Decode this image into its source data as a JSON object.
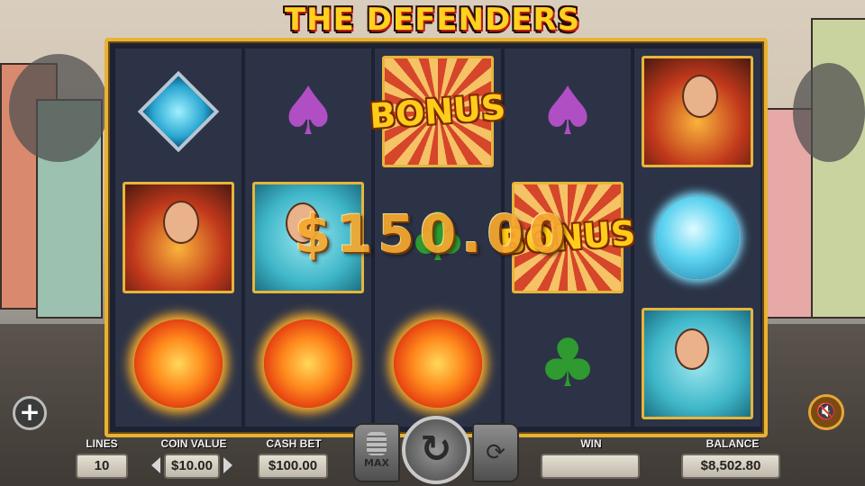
{
  "title": "THE DEFENDERS",
  "reels": [
    [
      "diamond-gem",
      "hero",
      "fire-orb"
    ],
    [
      "spade",
      "heroine",
      "fire-orb"
    ],
    [
      "bonus",
      "club",
      "fire-orb"
    ],
    [
      "spade",
      "bonus",
      "club"
    ],
    [
      "hero",
      "ice-orb",
      "heroine"
    ]
  ],
  "bonus_label": "BONUS",
  "win_amount": "$150.00",
  "controls": {
    "lines_label": "LINES",
    "lines_value": "10",
    "coin_value_label": "COIN VALUE",
    "coin_value": "$10.00",
    "cash_bet_label": "CASH BET",
    "cash_bet_value": "$100.00",
    "max_label": "MAX",
    "win_label": "WIN",
    "win_value": "",
    "balance_label": "BALANCE",
    "balance_value": "$8,502.80"
  },
  "icons": {
    "menu": "plus-icon",
    "sound": "speaker-muted-icon",
    "spin": "spin-arrow-icon",
    "autoplay": "autoplay-icon",
    "max_bet": "coin-stack-icon",
    "coin_down": "triangle-left-icon",
    "coin_up": "triangle-right-icon"
  },
  "colors": {
    "frame": "#e9b234",
    "title": "#ffd21f",
    "win_text": "#f7a92e"
  }
}
